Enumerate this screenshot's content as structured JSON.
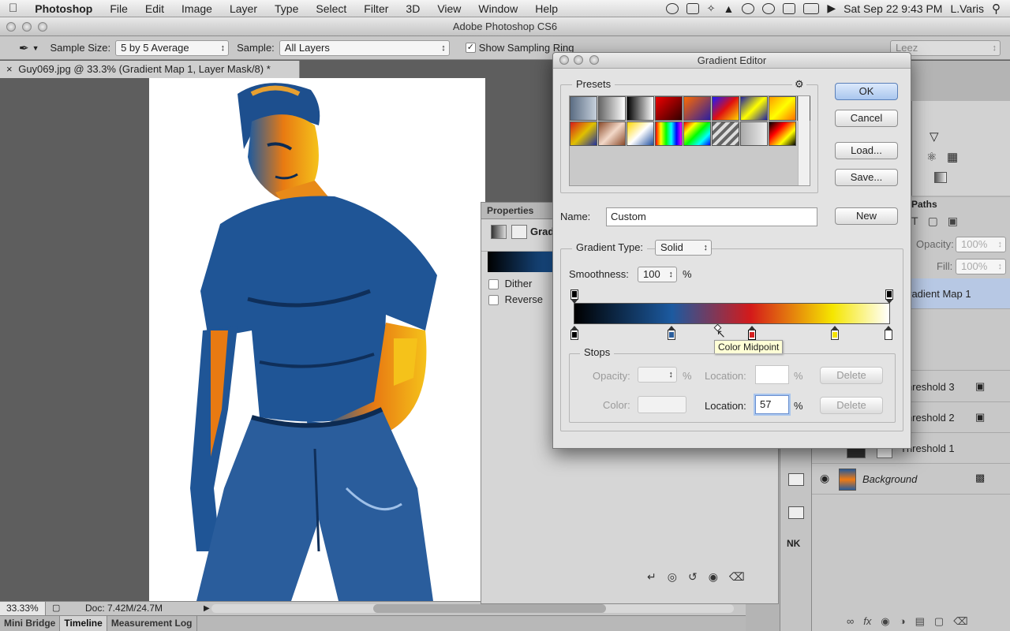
{
  "menubar": {
    "app": "Photoshop",
    "menus": [
      "File",
      "Edit",
      "Image",
      "Layer",
      "Type",
      "Select",
      "Filter",
      "3D",
      "View",
      "Window",
      "Help"
    ],
    "clock": "Sat Sep 22  9:43 PM",
    "user": "L.Varis"
  },
  "window": {
    "title": "Adobe Photoshop CS6"
  },
  "options": {
    "sample_size_label": "Sample Size:",
    "sample_size_value": "5 by 5 Average",
    "sample_label": "Sample:",
    "sample_value": "All Layers",
    "show_ring_label": "Show Sampling Ring",
    "workspace_value": "Leez"
  },
  "document": {
    "tab_title": "Guy069.jpg @ 33.3% (Gradient Map 1, Layer Mask/8) *"
  },
  "status": {
    "zoom": "33.33%",
    "doc_info": "Doc: 7.42M/24.7M"
  },
  "bottom_tabs": [
    "Mini Bridge",
    "Timeline",
    "Measurement Log"
  ],
  "properties": {
    "title": "Properties",
    "gradient_label": "Grad",
    "dither_label": "Dither",
    "reverse_label": "Reverse"
  },
  "layers": {
    "paths_tab": "Paths",
    "opacity_label": "Opacity:",
    "opacity_value": "100%",
    "fill_label": "Fill:",
    "fill_value": "100%",
    "items": [
      {
        "name": "Gradient Map 1"
      },
      {
        "name": "Threshold 3"
      },
      {
        "name": "Threshold 2"
      },
      {
        "name": "Threshold 1"
      },
      {
        "name": "Background"
      }
    ]
  },
  "dialog": {
    "title": "Gradient Editor",
    "presets_label": "Presets",
    "ok_label": "OK",
    "cancel_label": "Cancel",
    "load_label": "Load...",
    "save_label": "Save...",
    "name_label": "Name:",
    "name_value": "Custom",
    "new_label": "New",
    "gradient_type_label": "Gradient Type:",
    "gradient_type_value": "Solid",
    "smoothness_label": "Smoothness:",
    "smoothness_value": "100",
    "percent": "%",
    "tooltip": "Color Midpoint",
    "stops_label": "Stops",
    "opacity_label": "Opacity:",
    "color_label": "Color:",
    "location_label": "Location:",
    "location_value": "57",
    "delete_label": "Delete",
    "gradient_colors": [
      "#000000",
      "#1c5aa0",
      "#d41a1a",
      "#f5e600",
      "#ffffff"
    ],
    "stop_colors": [
      "#000000",
      "#2b5e9c",
      "#d52020",
      "#f4e300",
      "#ffffff"
    ]
  }
}
